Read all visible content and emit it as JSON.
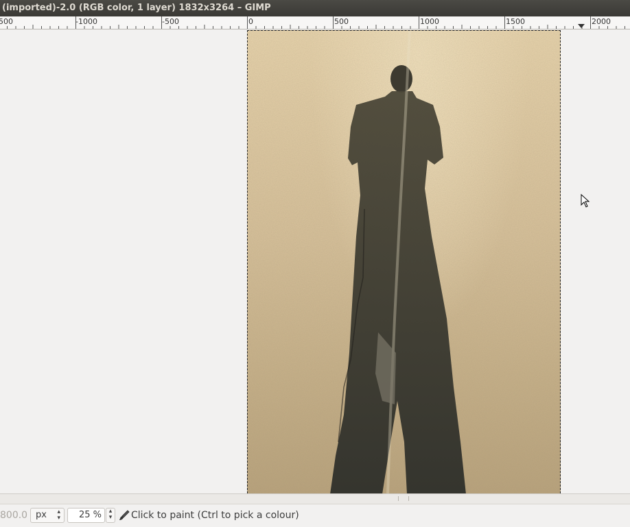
{
  "window": {
    "title": "(imported)-2.0 (RGB color, 1 layer) 1832x3264 – GIMP"
  },
  "ruler": {
    "labels": [
      "500",
      "-1000",
      "-500",
      "0",
      "500",
      "1000",
      "1500",
      "2000"
    ],
    "marker_icon": "triangle-down-icon"
  },
  "canvas": {
    "image_description_icon": "photo-shadow-image"
  },
  "statusbar": {
    "coords": "800.0",
    "unit": "px",
    "zoom": "25 %",
    "tool_icon": "paintbrush-icon",
    "message": "Click to paint (Ctrl to pick a colour)"
  },
  "colors": {
    "titlebar": "#3c3b37",
    "title_text": "#dfdbd2",
    "workspace": "#f2f1f0"
  }
}
